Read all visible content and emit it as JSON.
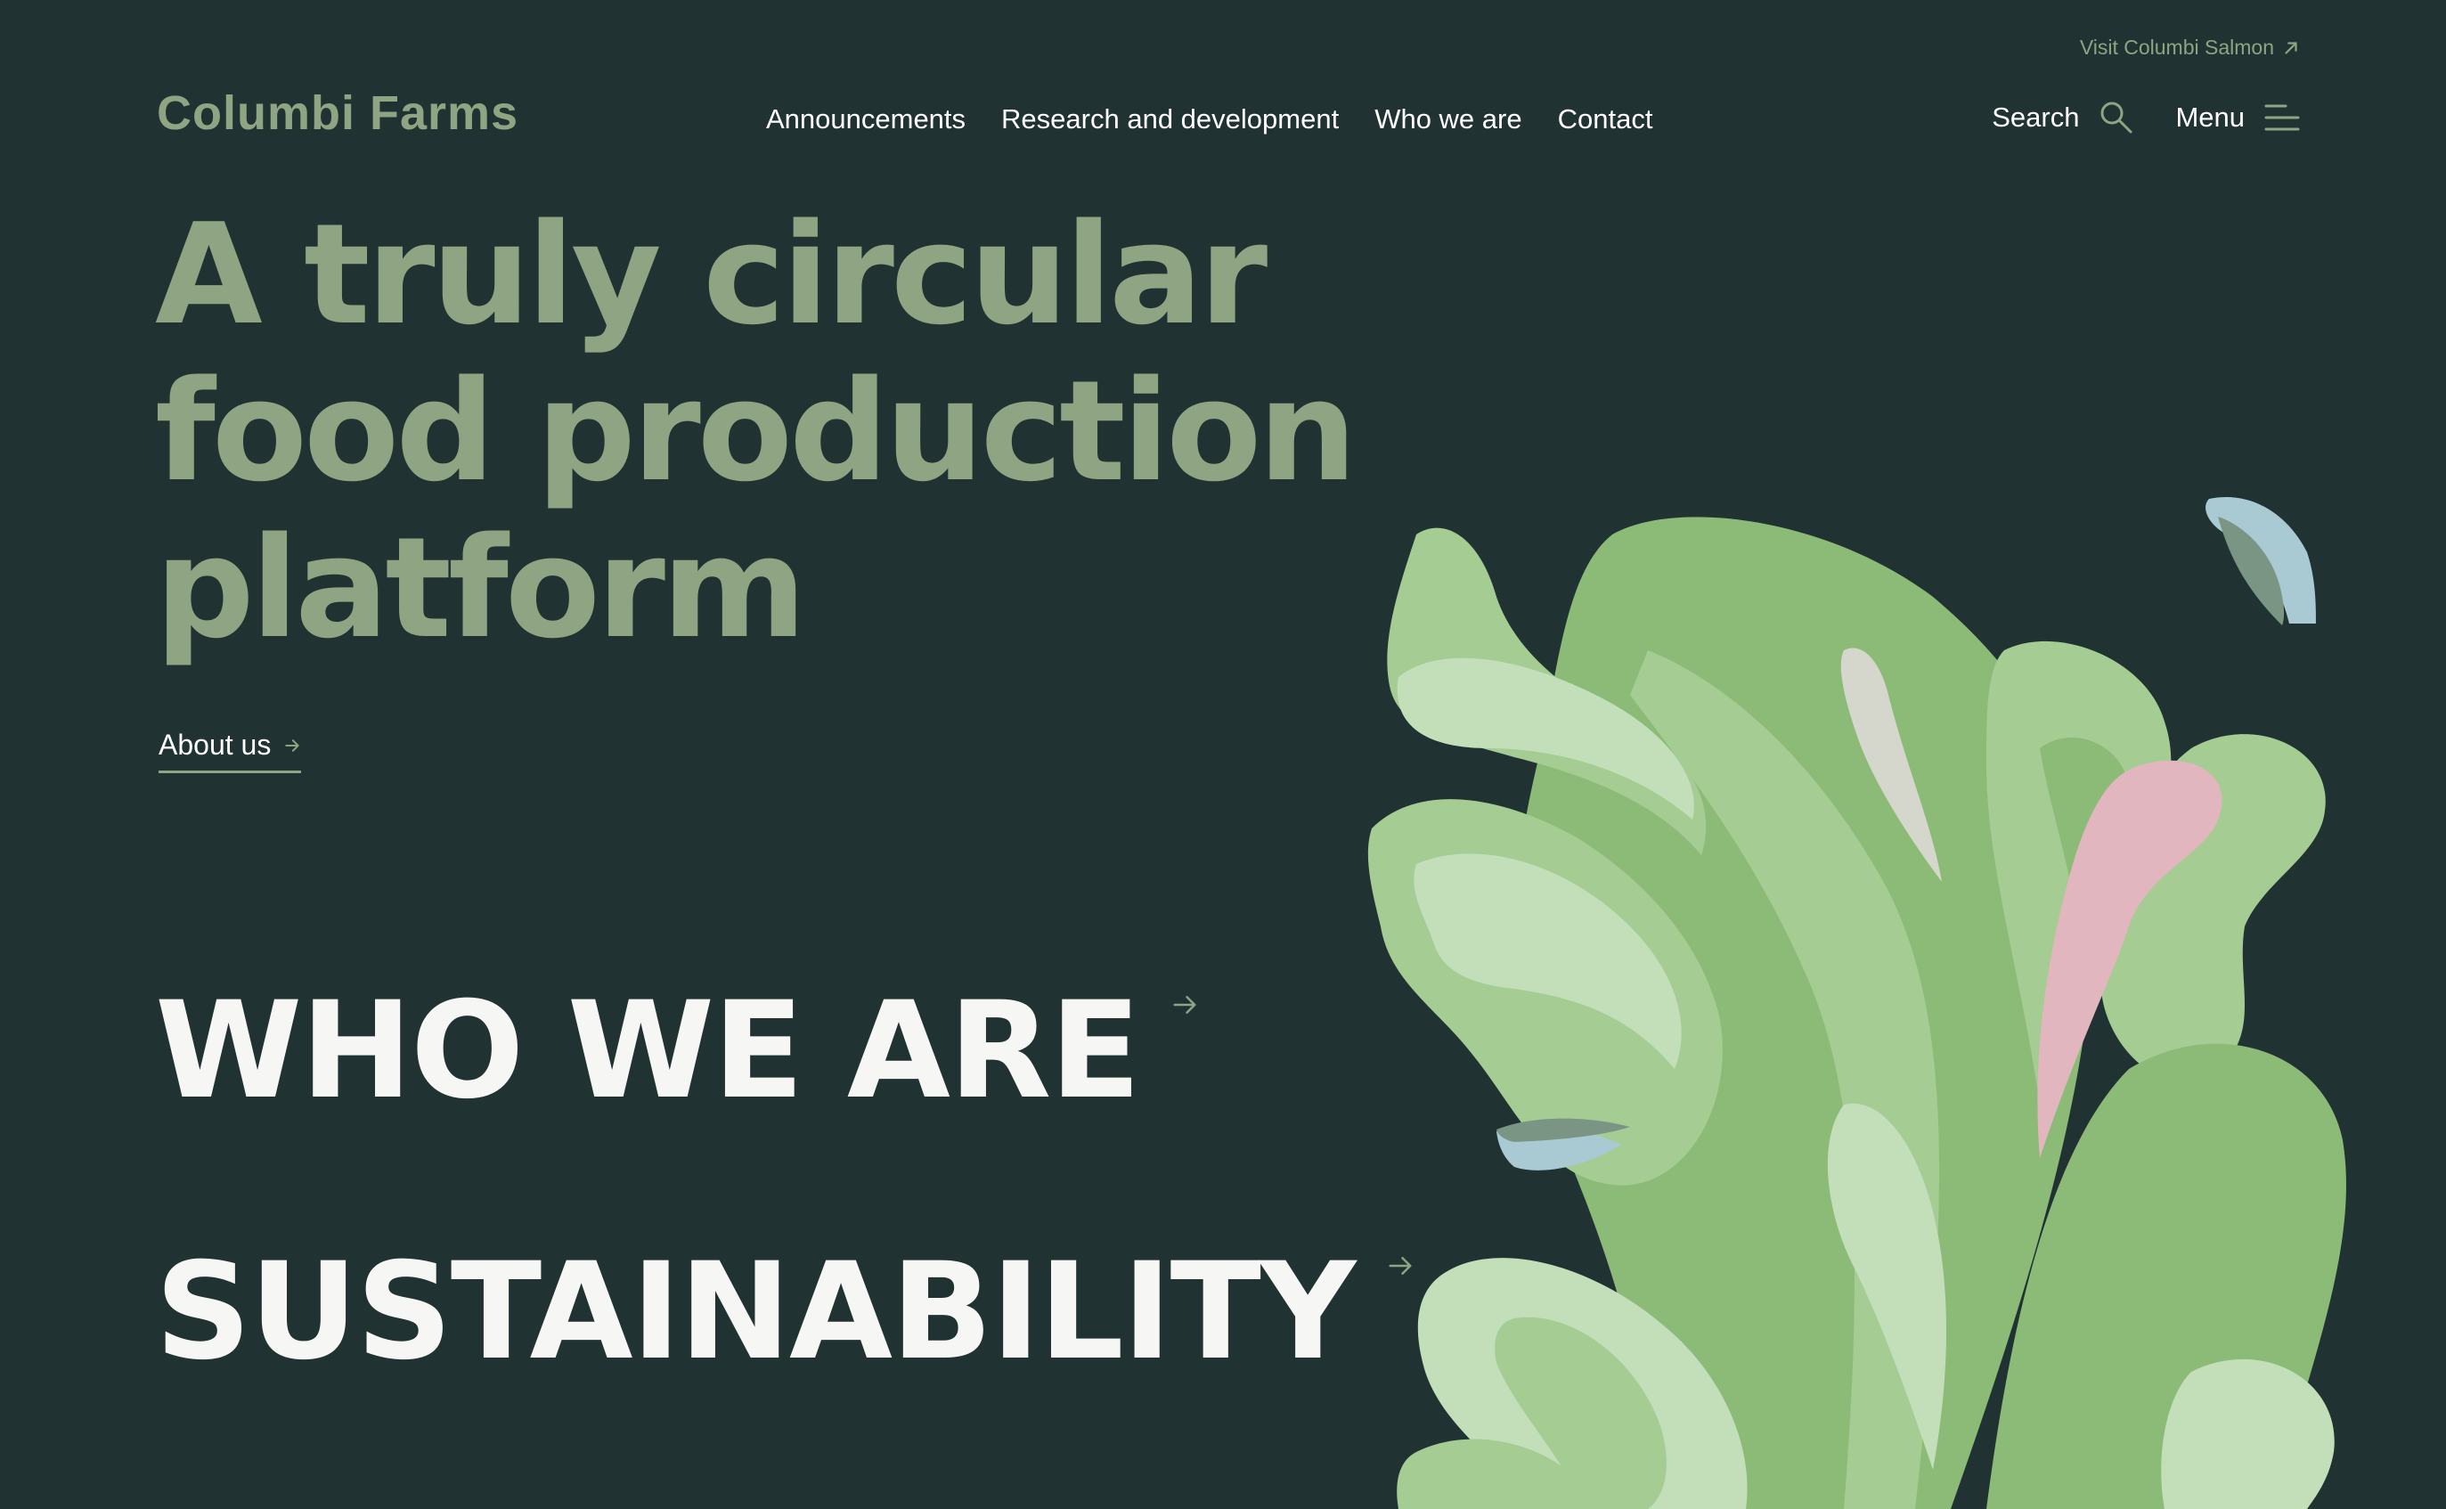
{
  "header": {
    "visit_link": "Visit Columbi Salmon",
    "logo": "Columbi Farms",
    "nav": [
      "Announcements",
      "Research and development",
      "Who we are",
      "Contact"
    ],
    "search_label": "Search",
    "menu_label": "Menu"
  },
  "hero": {
    "title": "A truly circular food production platform",
    "cta_label": "About us"
  },
  "sections": [
    {
      "label": "WHO WE ARE"
    },
    {
      "label": "SUSTAINABILITY"
    }
  ],
  "colors": {
    "background": "#203232",
    "accent_green": "#8fa482",
    "text": "#ffffff",
    "leaf_dark": "#8cbb78",
    "leaf_mid": "#a5cc92",
    "leaf_light": "#c2dfba",
    "leaf_pink": "#e2b6bf",
    "leaf_blue": "#a9c9d3"
  },
  "icons": {
    "visit": "external-arrow-icon",
    "search": "search-icon",
    "menu": "hamburger-icon",
    "arrow": "arrow-right-icon"
  }
}
